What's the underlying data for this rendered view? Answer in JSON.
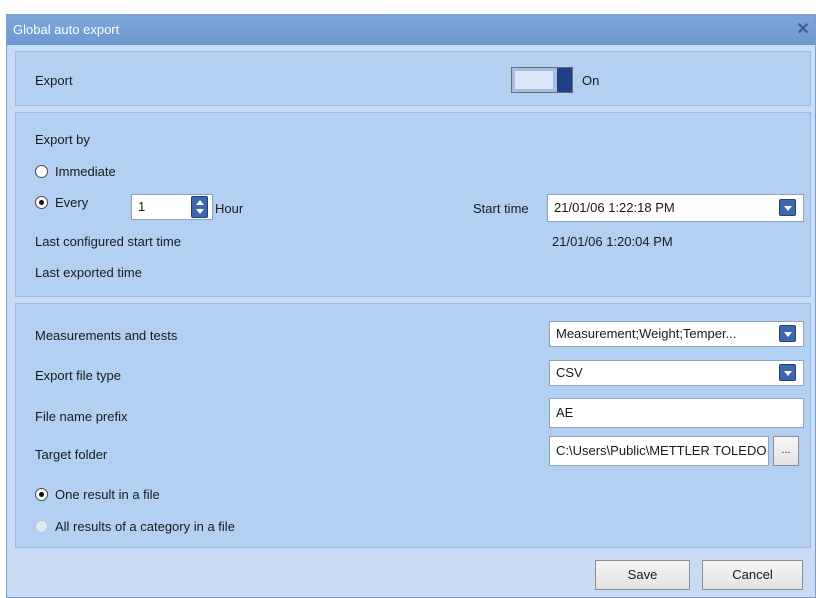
{
  "dialog": {
    "title": "Global auto export"
  },
  "export": {
    "label": "Export",
    "state": "On"
  },
  "export_by": {
    "heading": "Export by",
    "immediate_label": "Immediate",
    "every_label": "Every",
    "every_value": "1",
    "unit_label": "Hour",
    "start_time_label": "Start time",
    "start_time_value": "21/01/06 1:22:18 PM",
    "last_configured_label": "Last configured start time",
    "last_configured_value": "21/01/06 1:20:04 PM",
    "last_exported_label": "Last exported time",
    "last_exported_value": ""
  },
  "settings": {
    "measurements_label": "Measurements and tests",
    "measurements_value": "Measurement;Weight;Temper...",
    "file_type_label": "Export file type",
    "file_type_value": "CSV",
    "prefix_label": "File name prefix",
    "prefix_value": "AE",
    "folder_label": "Target folder",
    "folder_value": "C:\\Users\\Public\\METTLER TOLEDO",
    "browse_label": "...",
    "one_result_label": "One result in a file",
    "all_results_label": "All results of a category in a file"
  },
  "footer": {
    "save_label": "Save",
    "cancel_label": "Cancel"
  },
  "colors": {
    "titlebar": "#6d97cf",
    "panel": "#b3d0f2",
    "accent": "#3d68b0",
    "toggle_on": "#1f3f86"
  }
}
